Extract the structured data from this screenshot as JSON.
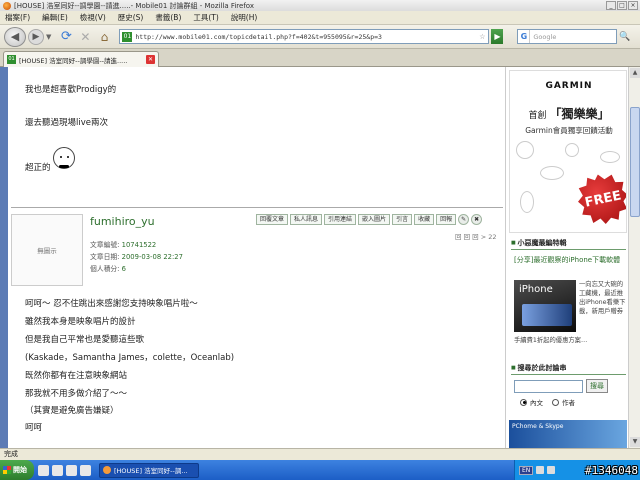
{
  "window": {
    "title": "[HOUSE] 浩室同好--調學園--請進.....- Mobile01 討論群組 - Mozilla Firefox",
    "buttons": [
      "_",
      "□",
      "×"
    ]
  },
  "menu": {
    "items": [
      "檔案(F)",
      "編輯(E)",
      "檢視(V)",
      "歷史(S)",
      "書籤(B)",
      "工具(T)",
      "說明(H)"
    ]
  },
  "nav": {
    "url": "http://www.mobile01.com/topicdetail.php?f=402&t=955095&r=25&p=3",
    "search_placeholder": "Google"
  },
  "tab": {
    "label": "[HOUSE] 浩室同好--調學園--請進....."
  },
  "post_prev": {
    "lines": [
      "我也是超喜歡Prodigy的",
      "還去聽過現場live兩次",
      "超正的"
    ]
  },
  "post": {
    "avatar_text": "無圖示",
    "author": "fumihiro_yu",
    "actions": [
      "回覆文章",
      "私人訊息",
      "引用連結",
      "嵌入圖片",
      "引言",
      "收藏",
      "回報"
    ],
    "meta": [
      {
        "label": "文章編號:",
        "value": "10741522"
      },
      {
        "label": "文章日期:",
        "value": "2009-03-08 22:27"
      },
      {
        "label": "個人積分:",
        "value": "6"
      }
    ],
    "page_indicator": "回 回 回 > 22",
    "lines": [
      "呵呵～ 忍不住跳出來感謝您支持映象唱片啦～",
      "雖然我本身是映象唱片的設計",
      "但是我自己平常也是愛聽這些歌",
      "(Kaskade，Samantha James，colette，Oceanlab)",
      "既然你都有在注意映象網站",
      "那我就不用多做介紹了～～",
      "（其實是避免廣告嫌疑）",
      "呵呵"
    ]
  },
  "sidebar": {
    "garmin": {
      "logo": "GARMIN",
      "headline_prefix": "首創",
      "headline": "「獨樂樂」",
      "sub": "Garmin會員獨享回饋活動",
      "badge": "FREE"
    },
    "editor_head": "小惡魔最編特輯",
    "news_title": "[分享]最近觀察的iPhone下載軟體",
    "iphone_label": "iPhone",
    "news_desc": "一向忘又大碗的工藏機，最近推出iPhone看樂下載，新用戶贈券",
    "news_desc2": "手續費1折起的優惠方案…",
    "search_head": "搜尋於此討論串",
    "search_btn": "搜尋",
    "radio_content": "內文",
    "radio_author": "作者",
    "pchome": "PChome & Skype"
  },
  "status": {
    "text": "完成"
  },
  "taskbar": {
    "start": "開始",
    "task": "[HOUSE] 浩室同好--調...",
    "lang": "EN",
    "watermark": "#1346048"
  }
}
